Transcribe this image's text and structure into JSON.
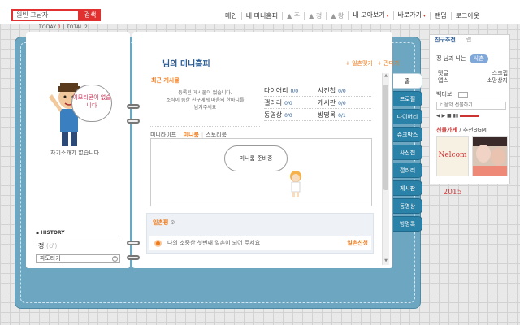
{
  "topbar": {
    "search_value": "원빈 그남자",
    "search_button": "검색",
    "nav": [
      {
        "id": "main",
        "label": "메인"
      },
      {
        "id": "my",
        "label": "내 미니홈피"
      },
      {
        "id": "up",
        "label": "▲ 주"
      },
      {
        "id": "mid",
        "label": "▲ 정"
      },
      {
        "id": "right",
        "label": "▲ 왕"
      },
      {
        "id": "collect",
        "label": "내 모아보기"
      },
      {
        "id": "shortcut",
        "label": "바로가기"
      },
      {
        "id": "random",
        "label": "랜덤"
      },
      {
        "id": "logout",
        "label": "로그아웃"
      }
    ]
  },
  "diary": {
    "counter": {
      "today_label": "TODAY",
      "today_value": "1",
      "sep": "|",
      "total_label": "TOTAL",
      "total_value": "2"
    },
    "title": "님의 미니홈피",
    "header_links": [
      "+ 일촌맺기",
      "+ 관디가"
    ],
    "profile": {
      "speech": "이모티콘이 없습니다",
      "intro": "자기소개가 없습니다.",
      "history_label": "HISTORY",
      "name": "정",
      "name_suffix": "(♂)",
      "select_value": "파도타기",
      "select_arrow": "▾"
    },
    "recent": {
      "title": "최근 게시물",
      "message_lines": [
        "등록된 게시물이 없습니다.",
        "소식이 뜸한 친구에게 마음의 한마디를",
        "남겨주세요"
      ]
    },
    "stats": [
      [
        {
          "label": "다이어리",
          "count": "0/0"
        },
        {
          "label": "사진첩",
          "count": "0/0"
        }
      ],
      [
        {
          "label": "갤러리",
          "count": "0/0"
        },
        {
          "label": "게시판",
          "count": "0/0"
        }
      ],
      [
        {
          "label": "동영상",
          "count": "0/0"
        },
        {
          "label": "방명록",
          "count": "0/1"
        }
      ]
    ],
    "room_tabs": {
      "tab1": "미니라이프",
      "tab2": "미니룸",
      "tab3": "스토리룸",
      "sep": "|"
    },
    "room_bubble": "미니룸 준비중",
    "guest": {
      "title": "일촌평",
      "gear": "⚙",
      "entry": "나의 소중한 첫번째 일촌이 되어 주세요",
      "link": "일촌신청"
    },
    "side_tabs": [
      "홈",
      "프로필",
      "다이어리",
      "쥬크박스",
      "사진첩",
      "갤러리",
      "게시판",
      "동영상",
      "방명록"
    ]
  },
  "widget": {
    "tabs": [
      "친구추천",
      "랩"
    ],
    "friend": {
      "name": "정",
      "blur": "   ",
      "text": "님과 나는",
      "accept": "사촌"
    },
    "grid": [
      [
        "댓글",
        "스크랩"
      ],
      [
        "앱스",
        "소망상자"
      ]
    ],
    "cherry": "벡터보",
    "music": "♪ 음악 선물하기",
    "player": "◀ ▶ ■ ▮▮",
    "selection": {
      "title": "선물가게",
      "rest": "/ 추천BGM"
    },
    "thumb_a": "Nelcom 2015"
  }
}
